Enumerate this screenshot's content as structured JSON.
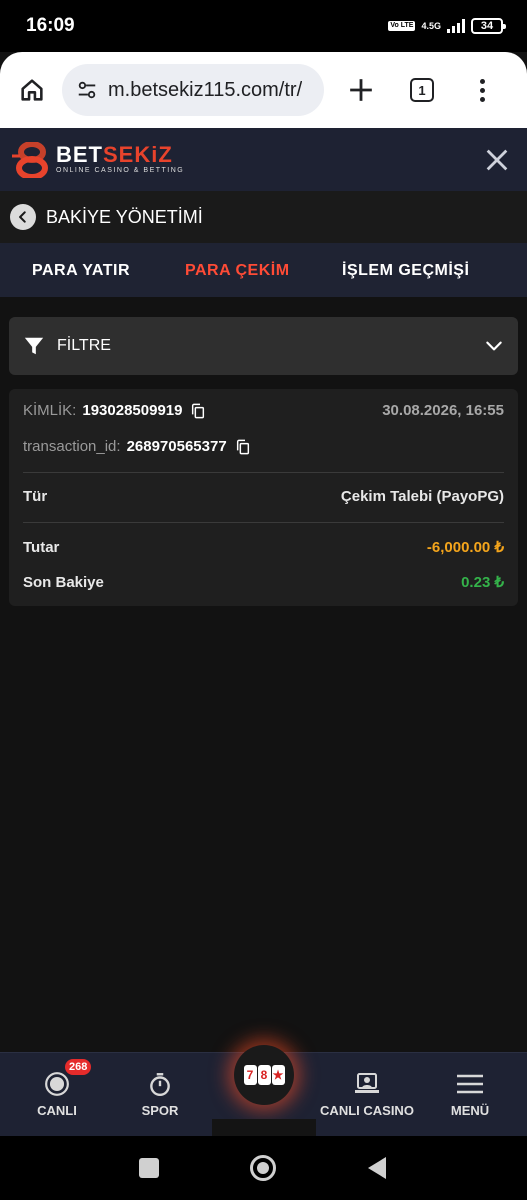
{
  "status_bar": {
    "time": "16:09",
    "network": "4.5G",
    "volte": "Vo LTE",
    "battery": "34"
  },
  "browser": {
    "url": "m.betsekiz115.com/tr/",
    "tab_count": "1"
  },
  "site": {
    "brand_bet": "BET",
    "brand_sekiz": "SEKiZ",
    "tagline": "ONLINE CASINO & BETTING"
  },
  "page": {
    "title": "BAKİYE YÖNETİMİ"
  },
  "tabs": [
    {
      "label": "PARA YATIR",
      "active": false
    },
    {
      "label": "PARA ÇEKİM",
      "active": true
    },
    {
      "label": "İŞLEM GEÇMİŞİ",
      "active": false
    }
  ],
  "filter": {
    "label": "FİLTRE"
  },
  "transaction": {
    "id_label": "KİMLİK:",
    "id_value": "193028509919",
    "datetime": "30.08.2026, 16:55",
    "txid_label": "transaction_id:",
    "txid_value": "268970565377",
    "type_label": "Tür",
    "type_value": "Çekim Talebi (PayoPG)",
    "amount_label": "Tutar",
    "amount_value": "-6,000.00 ₺",
    "balance_label": "Son Bakiye",
    "balance_value": "0.23 ₺"
  },
  "bottom_nav": {
    "live": "CANLI",
    "live_badge": "268",
    "sport": "SPOR",
    "slot_digits": [
      "7",
      "8",
      "★"
    ],
    "live_casino": "CANLI CASINO",
    "menu": "MENÜ"
  },
  "colors": {
    "accent": "#ff4b36",
    "negative": "#f4a51c",
    "positive": "#34b24a",
    "header_bg": "#1e2233"
  }
}
